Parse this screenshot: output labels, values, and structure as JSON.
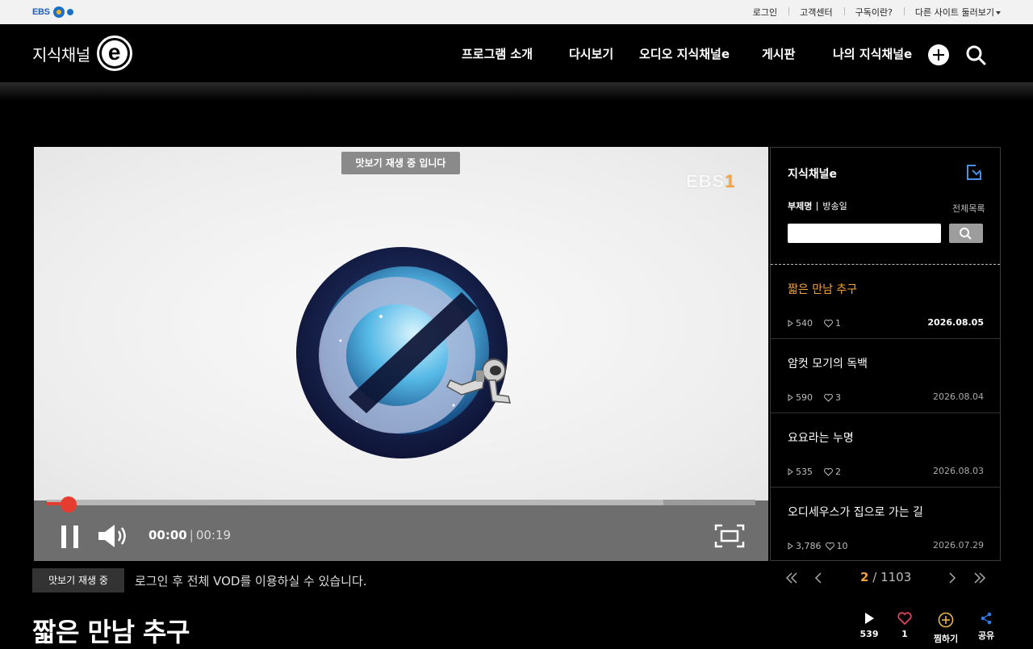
{
  "topbar": {
    "logo_text": "EBS",
    "links": [
      "로그인",
      "고객센터",
      "구독이란?",
      "다른 사이트 둘러보기"
    ]
  },
  "header": {
    "brand": "지식채널",
    "brand_mark": "e",
    "nav": [
      "프로그램 소개",
      "다시보기",
      "오디오 지식채널e",
      "게시판",
      "나의 지식채널e"
    ]
  },
  "player": {
    "preview_badge": "맛보기 재생 중 입니다",
    "channel_logo": "EBS",
    "channel_number": "1",
    "current_time": "00:00",
    "separator": "|",
    "duration": "00:19",
    "progress": 0.02,
    "buffered": 0.87
  },
  "side": {
    "title": "지식채널e",
    "tab_active": "부제명",
    "tab_other": "방송일",
    "all_list": "전체목록",
    "search_value": "",
    "episodes": [
      {
        "title": "짧은 만남 추구",
        "plays": "540",
        "likes": "1",
        "date": "2026.08.05",
        "active": true
      },
      {
        "title": "암컷 모기의 독백",
        "plays": "590",
        "likes": "3",
        "date": "2026.08.04",
        "active": false
      },
      {
        "title": "요요라는 누명",
        "plays": "535",
        "likes": "2",
        "date": "2026.08.03",
        "active": false
      },
      {
        "title": "오디세우스가 집으로 가는 길",
        "plays": "3,786",
        "likes": "10",
        "date": "2026.07.29",
        "active": false
      }
    ]
  },
  "below": {
    "preview_label": "맛보기 재생 중",
    "login_message": "로그인 후 전체 VOD를 이용하실 수 있습니다.",
    "pager_current": "2",
    "pager_sep": "/",
    "pager_total": "1103",
    "title": "짧은 만남 추구"
  },
  "actions": {
    "plays": "539",
    "likes": "1",
    "bookmark": "찜하기",
    "share": "공유"
  },
  "colors": {
    "accent": "#f5a33c",
    "progress": "#e53c2f",
    "share_blue": "#2f7be8",
    "like_red": "#e0435a",
    "bookmark_gold": "#e6b84a"
  }
}
